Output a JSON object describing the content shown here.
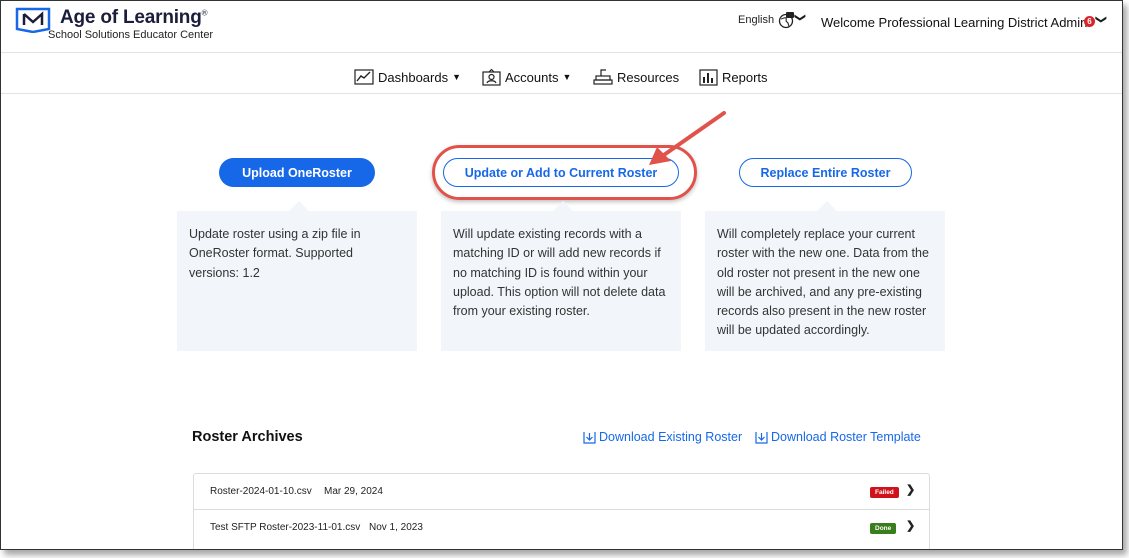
{
  "header": {
    "brand_name": "Age of Learning",
    "brand_mark": "®",
    "brand_sub": "School Solutions Educator Center",
    "language": "English",
    "welcome": "Welcome Professional Learning District Admin!",
    "notification_count": "6"
  },
  "nav": {
    "dashboards": "Dashboards",
    "accounts": "Accounts",
    "resources": "Resources",
    "reports": "Reports"
  },
  "actions": {
    "upload": {
      "label": "Upload OneRoster",
      "description": "Update roster using a zip file in OneRoster format. Supported versions: 1.2"
    },
    "update": {
      "label": "Update or Add to Current Roster",
      "description": "Will update existing records with a matching ID or will add new records if no matching ID is found within your upload. This option will not delete data from your existing roster."
    },
    "replace": {
      "label": "Replace Entire Roster",
      "description": "Will completely replace your current roster with the new one. Data from the old roster not present in the new one will be archived, and any pre-existing records also present in the new roster will be updated accordingly."
    }
  },
  "archives": {
    "title": "Roster Archives",
    "download_existing": "Download Existing Roster",
    "download_template": "Download Roster Template",
    "rows": [
      {
        "file": "Roster-2024-01-10.csv",
        "date": "Mar 29, 2024",
        "status": "Failed",
        "status_color": "#d0121b"
      },
      {
        "file": "Test SFTP Roster-2023-11-01.csv",
        "date": "Nov 1, 2023",
        "status": "Done",
        "status_color": "#3a7d1c"
      }
    ]
  },
  "colors": {
    "accent": "#1768e8",
    "highlight": "#e0524a",
    "card_bg": "#f2f6fa"
  }
}
